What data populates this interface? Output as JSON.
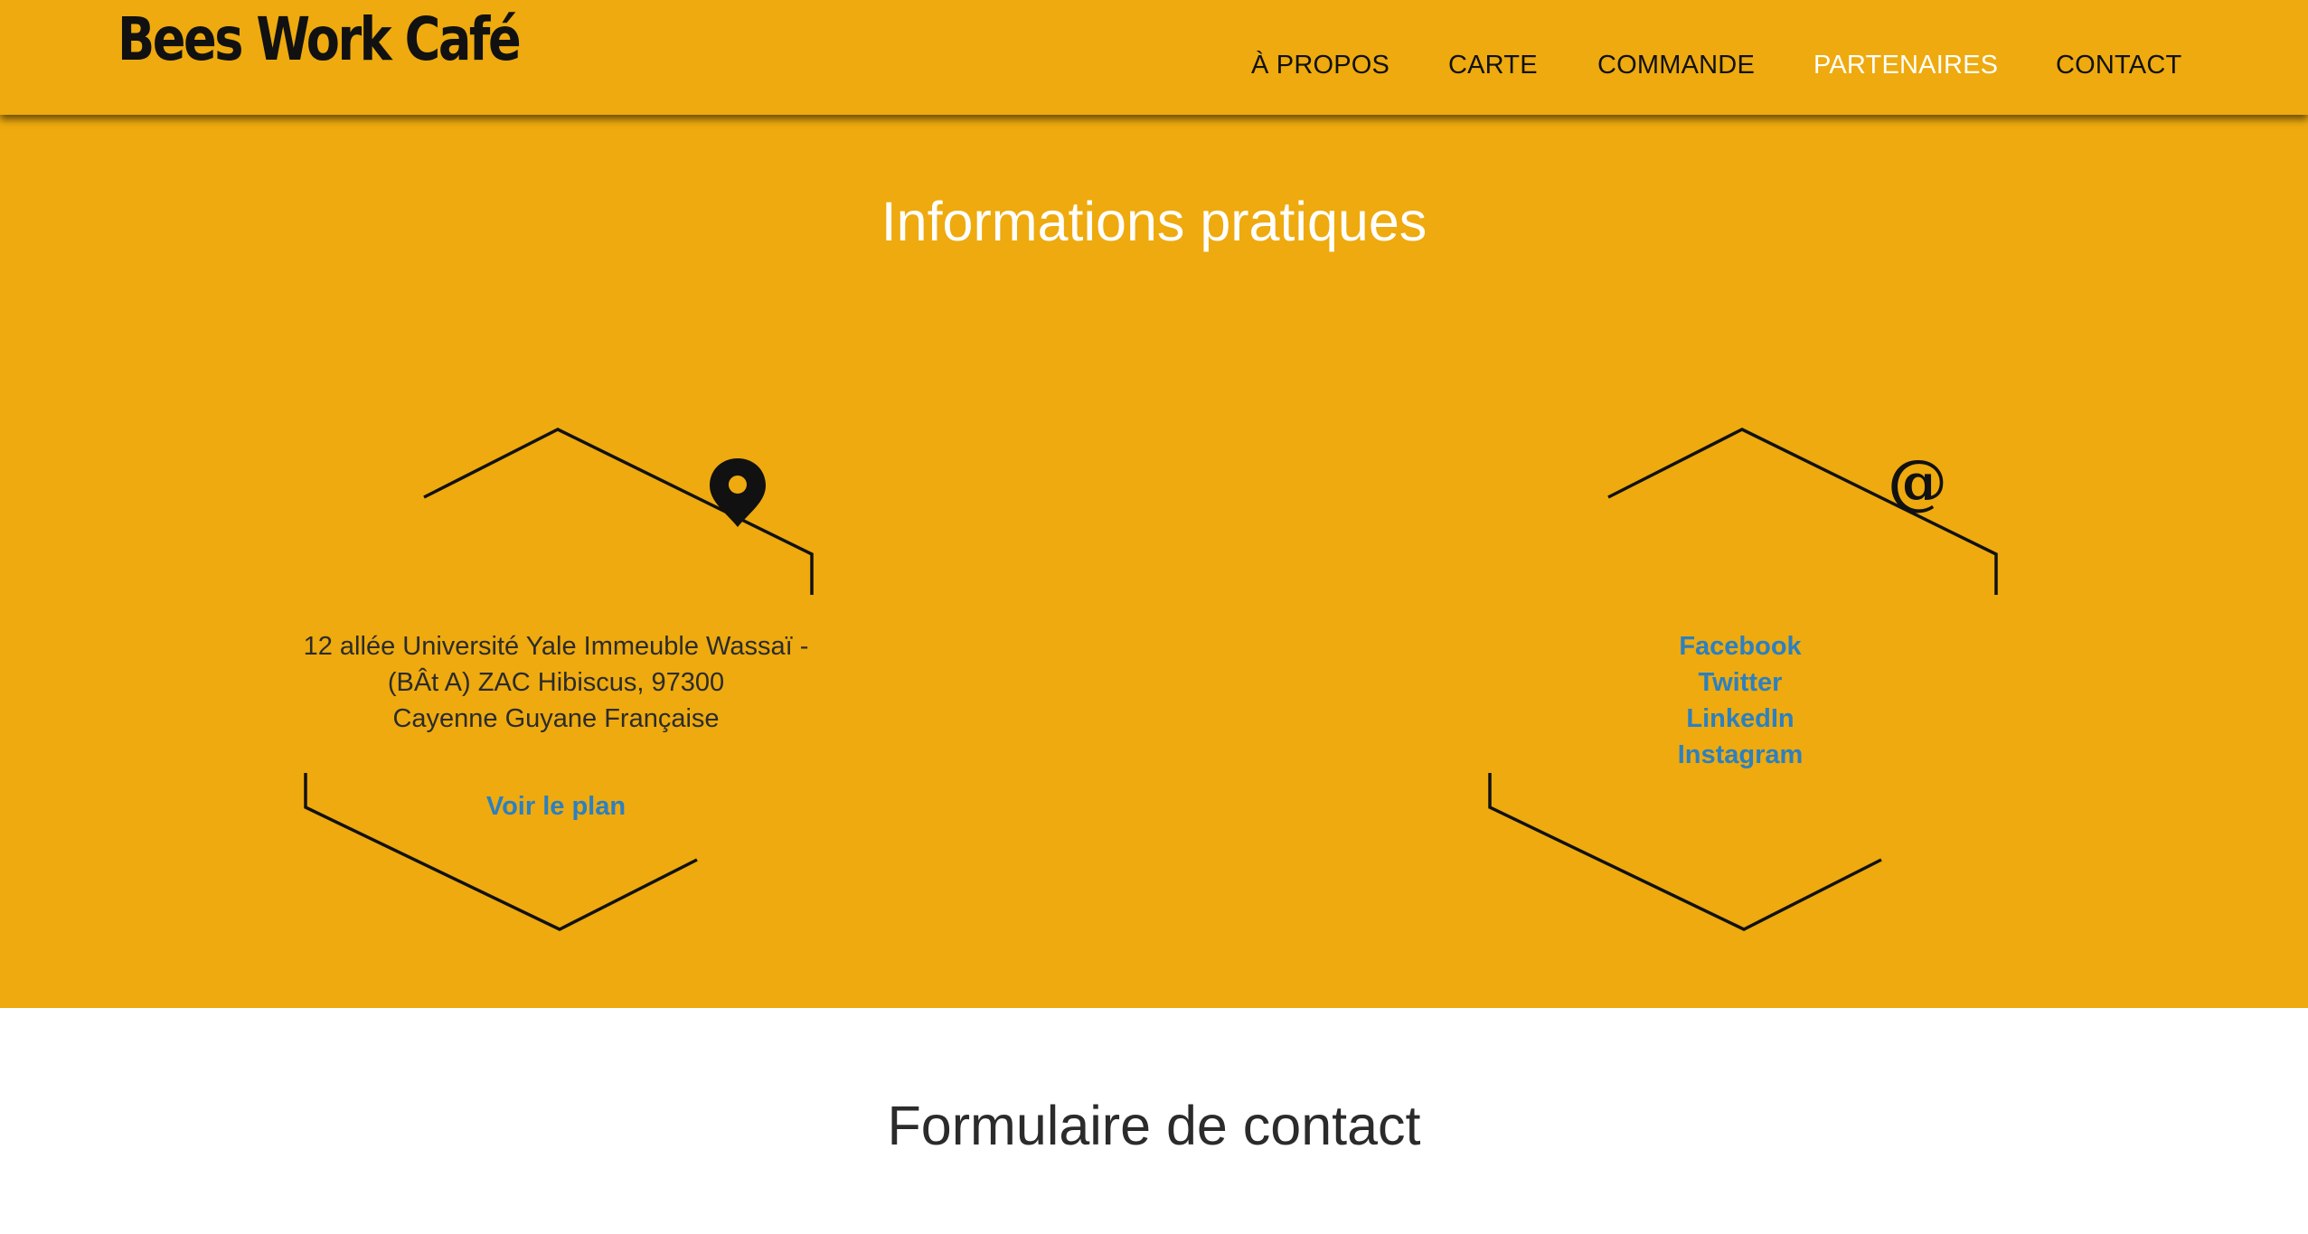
{
  "header": {
    "brand": "Bees Work Café",
    "nav": [
      {
        "label": "À PROPOS",
        "active": false
      },
      {
        "label": "CARTE",
        "active": false
      },
      {
        "label": "COMMANDE",
        "active": false
      },
      {
        "label": "PARTENAIRES",
        "active": true
      },
      {
        "label": "CONTACT",
        "active": false
      }
    ]
  },
  "info": {
    "title": "Informations pratiques",
    "address_lines": [
      "12 allée Université Yale Immeuble Wassaï -",
      "(BÂt A) ZAC Hibiscus, 97300",
      "Cayenne Guyane Française"
    ],
    "map_link": "Voir le plan",
    "socials": [
      "Facebook",
      "Twitter",
      "LinkedIn",
      "Instagram"
    ],
    "icons": [
      "map-pin-icon",
      "at-sign-icon"
    ]
  },
  "contact_form": {
    "title": "Formulaire de contact"
  },
  "colors": {
    "brand_yellow": "#eeaa0e",
    "link_blue": "#2c80c0",
    "text_dark": "#2b2b2b"
  }
}
